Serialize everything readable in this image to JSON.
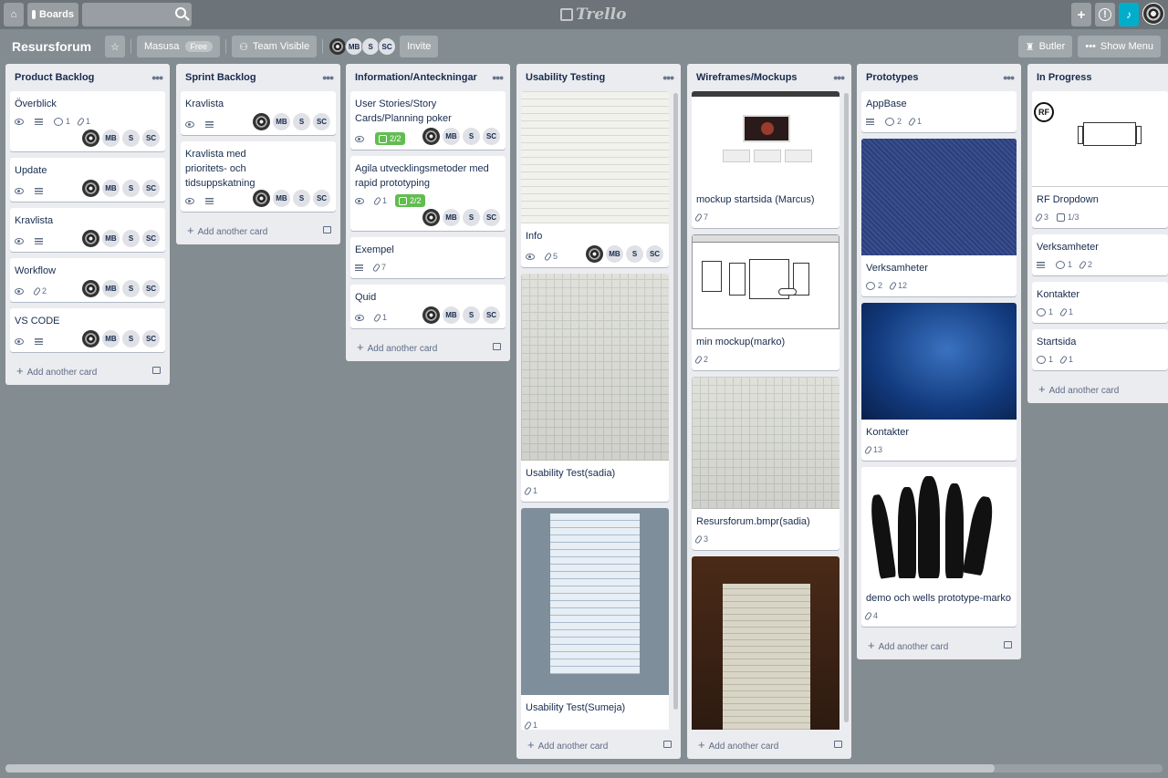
{
  "topbar": {
    "boards_label": "Boards",
    "logo_text": "Trello",
    "search_placeholder": ""
  },
  "header": {
    "board_name": "Resursforum",
    "workspace": "Masusa",
    "plan": "Free",
    "visibility": "Team Visible",
    "members": [
      "MB",
      "S",
      "SC"
    ],
    "invite_label": "Invite",
    "butler_label": "Butler",
    "menu_label": "Show Menu"
  },
  "add_card_label": "Add another card",
  "lists": [
    {
      "title": "Product Backlog",
      "cards": [
        {
          "title": "Överblick",
          "comments": "1",
          "attachments": "1",
          "members": [
            "MB",
            "S",
            "SC"
          ]
        },
        {
          "title": "Update",
          "members": [
            "MB",
            "S",
            "SC"
          ]
        },
        {
          "title": "Kravlista",
          "members": [
            "MB",
            "S",
            "SC"
          ]
        },
        {
          "title": "Workflow",
          "attachments": "2",
          "members": [
            "MB",
            "S",
            "SC"
          ]
        },
        {
          "title": "VS CODE",
          "members": [
            "MB",
            "S",
            "SC"
          ]
        }
      ]
    },
    {
      "title": "Sprint Backlog",
      "cards": [
        {
          "title": "Kravlista",
          "members": [
            "MB",
            "S",
            "SC"
          ]
        },
        {
          "title": "Kravlista med prioritets- och tidsuppskatning",
          "members": [
            "MB",
            "S",
            "SC"
          ]
        }
      ]
    },
    {
      "title": "Information/Anteckningar",
      "cards": [
        {
          "title": "User Stories/Story Cards/Planning poker",
          "checklist": "2/2",
          "members": [
            "MB",
            "S",
            "SC"
          ]
        },
        {
          "title": "Agila utvecklingsmetoder med rapid prototyping",
          "attachments": "1",
          "checklist": "2/2",
          "members": [
            "MB",
            "S",
            "SC"
          ]
        },
        {
          "title": "Exempel",
          "attachments": "7"
        },
        {
          "title": "Quid",
          "attachments": "1",
          "members": [
            "MB",
            "S",
            "SC"
          ]
        }
      ]
    },
    {
      "title": "Usability Testing",
      "cards": [
        {
          "title": "Info",
          "attachments": "5",
          "members": [
            "MB",
            "S",
            "SC"
          ]
        },
        {
          "title": "Usability Test(sadia)",
          "attachments": "1"
        },
        {
          "title": "Usability Test(Sumeja)",
          "attachments": "1"
        }
      ]
    },
    {
      "title": "Wireframes/Mockups",
      "cards": [
        {
          "title": "mockup startsida (Marcus)",
          "attachments": "7"
        },
        {
          "title": "min mockup(marko)",
          "attachments": "2"
        },
        {
          "title": "Resursforum.bmpr(sadia)",
          "attachments": "3"
        }
      ]
    },
    {
      "title": "Prototypes",
      "cards": [
        {
          "title": "AppBase",
          "comments": "2",
          "attachments": "1"
        },
        {
          "title": "Verksamheter",
          "comments": "2",
          "attachments": "12"
        },
        {
          "title": "Kontakter",
          "attachments": "13"
        },
        {
          "title": "demo och wells prototype-marko",
          "attachments": "4"
        }
      ]
    },
    {
      "title": "In Progress",
      "cards": [
        {
          "title": "RF Dropdown",
          "attachments": "3",
          "checklist": "1/3",
          "cover_text": "RF"
        },
        {
          "title": "Verksamheter",
          "comments": "1",
          "attachments": "2"
        },
        {
          "title": "Kontakter",
          "comments": "1",
          "attachments": "1"
        },
        {
          "title": "Startsida",
          "comments": "1",
          "attachments": "1"
        }
      ]
    }
  ],
  "colors": {
    "background": "#838c91",
    "list": "#ebecf0",
    "checklist_done": "#61bd4f",
    "bell": "#00aecc"
  }
}
